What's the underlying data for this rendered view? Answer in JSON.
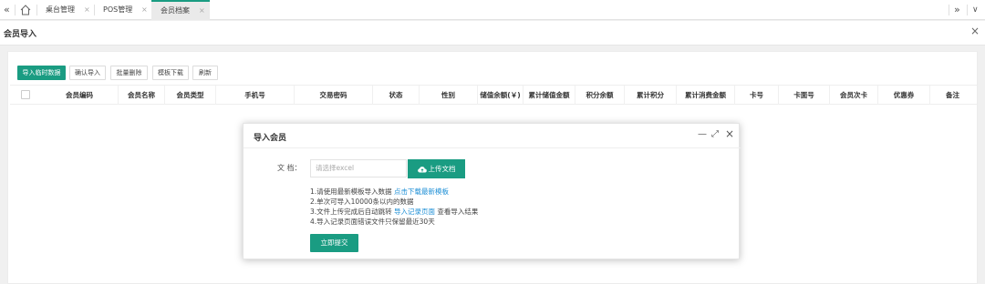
{
  "tabbar": {
    "nav_left": "«",
    "nav_right": "»",
    "more": "∨",
    "tabs": [
      {
        "label": "桌台管理",
        "close": "×"
      },
      {
        "label": "POS管理",
        "close": "×"
      },
      {
        "label": "会员档案",
        "close": "×",
        "active": true
      }
    ]
  },
  "page": {
    "title": "会员导入",
    "close": "×"
  },
  "toolbar": {
    "import_temp": "导入临时数据",
    "confirm_import": "确认导入",
    "batch_delete": "批量删除",
    "template_download": "模板下载",
    "refresh": "刷新"
  },
  "table": {
    "columns": [
      "会员编码",
      "会员名称",
      "会员类型",
      "手机号",
      "交易密码",
      "状态",
      "性别",
      "储值余额(￥)",
      "累计储值金额",
      "积分余额",
      "累计积分",
      "累计消费金额",
      "卡号",
      "卡面号",
      "会员次卡",
      "优惠券",
      "备注"
    ],
    "rows": []
  },
  "modal": {
    "title": "导入会员",
    "minimize": "—",
    "maximize": "⤢",
    "close": "×",
    "file_label": "文 档：",
    "file_placeholder": "请选择excel",
    "upload_label": "上传文档",
    "notes": [
      {
        "text": "1.请使用最新模板导入数据 ",
        "link": "点击下载最新模板",
        "after": ""
      },
      {
        "text": "2.单次可导入10000条以内的数据",
        "link": "",
        "after": ""
      },
      {
        "text": "3.文件上传完成后自动跳转 ",
        "link": "导入记录页面",
        "after": " 查看导入结果"
      },
      {
        "text": "4.导入记录页面错误文件只保留最近30天",
        "link": "",
        "after": ""
      }
    ],
    "submit_label": "立即提交"
  },
  "colors": {
    "accent": "#1a9c82",
    "link": "#1e8fd6",
    "overlay": "rgba(0,0,0,0.06)"
  },
  "icons": {
    "home": "home-icon",
    "upload": "cloud-upload-icon"
  }
}
